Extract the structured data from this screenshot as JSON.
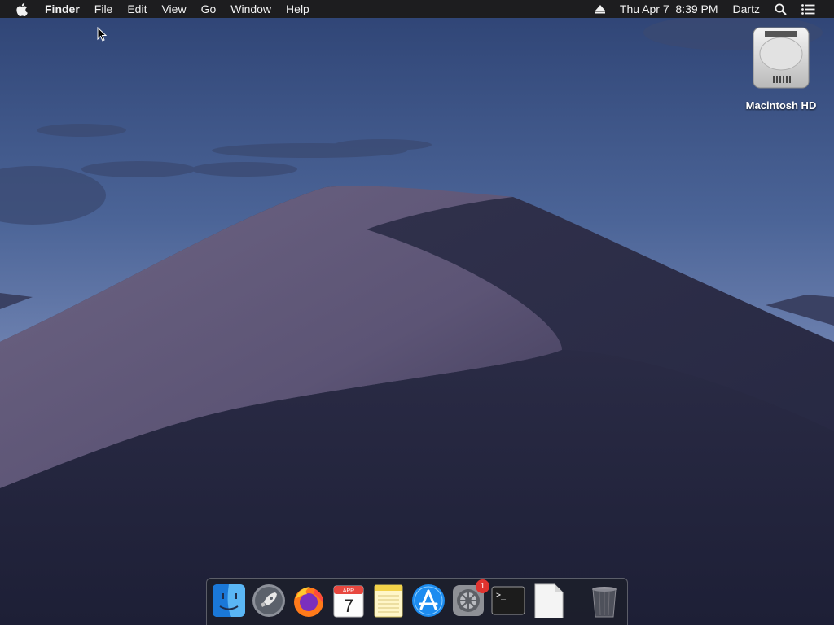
{
  "menubar": {
    "apple_icon": "apple-icon",
    "app_name": "Finder",
    "menus": [
      "File",
      "Edit",
      "View",
      "Go",
      "Window",
      "Help"
    ],
    "status": {
      "eject_icon": "eject-icon",
      "datetime": "Thu Apr 7  8:39 PM",
      "user": "Dartz",
      "spotlight_icon": "search-icon",
      "notification_icon": "list-icon"
    }
  },
  "desktop": {
    "icons": [
      {
        "label": "Macintosh HD",
        "icon": "hard-drive-icon"
      }
    ]
  },
  "dock": {
    "items": [
      {
        "name": "Finder",
        "icon": "finder-icon"
      },
      {
        "name": "Launchpad",
        "icon": "rocket-icon"
      },
      {
        "name": "Firefox",
        "icon": "firefox-icon"
      },
      {
        "name": "Calendar",
        "icon": "calendar-icon",
        "month": "APR",
        "day": "7"
      },
      {
        "name": "Notes",
        "icon": "notes-icon"
      },
      {
        "name": "App Store",
        "icon": "app-store-icon"
      },
      {
        "name": "System Preferences",
        "icon": "gear-icon",
        "badge": "1"
      },
      {
        "name": "Terminal",
        "icon": "terminal-icon",
        "prompt": ">_"
      },
      {
        "name": "Document",
        "icon": "document-icon"
      },
      {
        "name": "Trash",
        "icon": "trash-icon"
      }
    ]
  }
}
